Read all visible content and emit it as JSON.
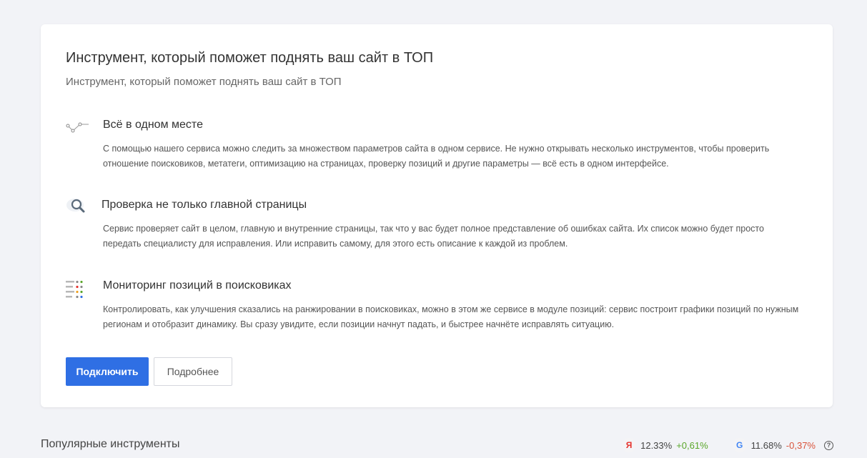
{
  "card": {
    "title": "Инструмент, который поможет поднять ваш сайт в ТОП",
    "subtitle": "Инструмент, который поможет поднять ваш сайт в ТОП",
    "features": [
      {
        "icon": "nodes-icon",
        "title": "Всё в одном месте",
        "text": "С помощью нашего сервиса можно следить за множеством параметров сайта в одном сервисе. Не нужно открывать несколько инструментов, чтобы проверить отношение поисковиков, метатеги, оптимизацию на страницах, проверку позиций и другие параметры — всё есть в одном интерфейсе."
      },
      {
        "icon": "magnifier-icon",
        "title": "Проверка не только главной страницы",
        "text": "Сервис проверяет сайт в целом, главную и внутренние страницы, так что у вас будет полное представление об ошибках сайта. Их список можно будет просто передать специалисту для исправления. Или исправить самому, для этого есть описание к каждой из проблем."
      },
      {
        "icon": "monitoring-list-icon",
        "title": "Мониторинг позиций в поисковиках",
        "text": "Контролировать, как улучшения сказались на ранжировании в поисковиках, можно в этом же сервисе в модуле позиций: сервис построит графики позиций по нужным регионам и отобразит динамику. Вы сразу увидите, если позиции начнут падать, и быстрее начнёте исправлять ситуацию."
      }
    ],
    "connect_label": "Подключить",
    "more_label": "Подробнее"
  },
  "footer": {
    "popular_title": "Популярные инструменты",
    "yandex": {
      "letter": "Я",
      "value": "12.33%",
      "change": "+0,61%"
    },
    "google": {
      "letter": "G",
      "value": "11.68%",
      "change": "-0,37%"
    },
    "help": "?"
  },
  "colors": {
    "primary": "#2f6fe4",
    "positive": "#5aa62a",
    "negative": "#d9533b",
    "yandex": "#e5322d",
    "background": "#f2f3f7"
  }
}
